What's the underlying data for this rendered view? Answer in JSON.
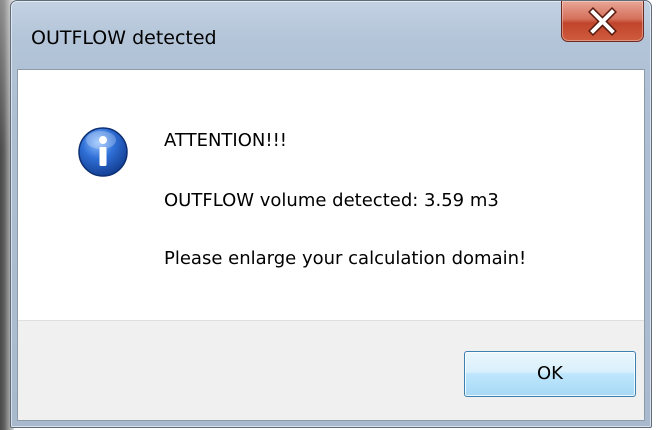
{
  "window": {
    "title": "OUTFLOW detected",
    "close_icon": "close-x-icon"
  },
  "message": {
    "icon": "info-icon",
    "heading": "ATTENTION!!!",
    "volume_line": "OUTFLOW volume detected:  3.59 m3",
    "instruction": "Please enlarge your calculation domain!"
  },
  "buttons": {
    "ok_label": "OK"
  },
  "colors": {
    "close_button": "#c7472d",
    "info_icon": "#2a63c4",
    "ok_button_border": "#3c7fb1",
    "footer_background": "#f0f0f0"
  }
}
